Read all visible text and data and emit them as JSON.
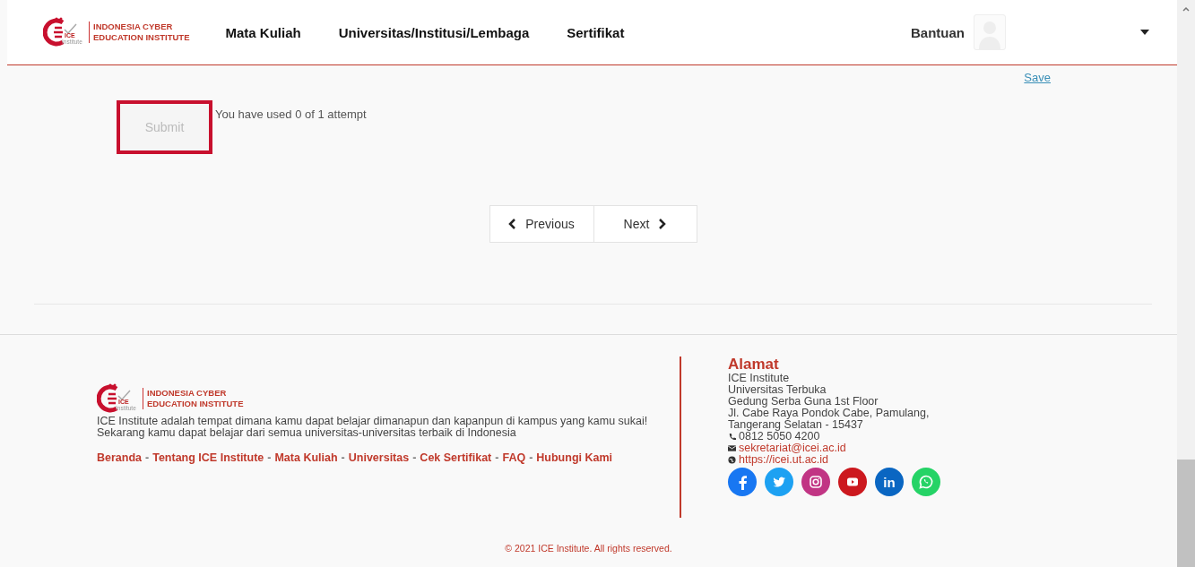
{
  "header": {
    "logo": {
      "mark_top": "ICE",
      "mark_bottom": "Institute",
      "line1": "INDONESIA CYBER",
      "line2": "EDUCATION INSTITUTE"
    },
    "nav": [
      {
        "label": "Mata Kuliah"
      },
      {
        "label": "Universitas/Institusi/Lembaga"
      },
      {
        "label": "Sertifikat"
      }
    ],
    "help": "Bantuan"
  },
  "quiz": {
    "save": "Save",
    "submit": {
      "label": "Submit",
      "disabled": true,
      "highlighted": true
    },
    "attempts": "You have used 0 of 1 attempt",
    "pager": [
      {
        "kind": "previous",
        "label": "Previous"
      },
      {
        "kind": "next",
        "label": "Next"
      }
    ]
  },
  "footer": {
    "logo": {
      "mark_top": "ICE",
      "mark_bottom": "Institute",
      "line1": "INDONESIA CYBER",
      "line2": "EDUCATION INSTITUTE"
    },
    "description": [
      "ICE Institute adalah tempat dimana kamu dapat belajar dimanapun dan kapanpun di kampus yang kamu sukai!",
      "Sekarang kamu dapat belajar dari semua universitas-universitas terbaik di Indonesia"
    ],
    "separator": "-",
    "links": [
      {
        "label": "Beranda"
      },
      {
        "label": "Tentang ICE Institute"
      },
      {
        "label": "Mata Kuliah"
      },
      {
        "label": "Universitas"
      },
      {
        "label": "Cek Sertifikat"
      },
      {
        "label": "FAQ"
      },
      {
        "label": "Hubungi Kami"
      }
    ],
    "address": {
      "title": "Alamat",
      "lines": [
        "ICE Institute",
        "Universitas Terbuka",
        "Gedung Serba Guna 1st Floor",
        "Jl. Cabe Raya Pondok Cabe, Pamulang,",
        "Tangerang Selatan - 15437"
      ],
      "contacts": [
        {
          "kind": "phone",
          "text": "0812 5050 4200"
        },
        {
          "kind": "email",
          "text": "sekretariat@icei.ac.id"
        },
        {
          "kind": "web",
          "text": "https://icei.ut.ac.id"
        }
      ]
    },
    "social": [
      {
        "kind": "facebook",
        "color": "#1877f2"
      },
      {
        "kind": "twitter",
        "color": "#1da1f2"
      },
      {
        "kind": "instagram",
        "color": "#c13584"
      },
      {
        "kind": "youtube",
        "color": "#cc181e"
      },
      {
        "kind": "linkedin",
        "color": "#0a66c2",
        "label": "in"
      },
      {
        "kind": "whatsapp",
        "color": "#25d366"
      }
    ],
    "copyright": "© 2021 ICE Institute. All rights reserved."
  }
}
